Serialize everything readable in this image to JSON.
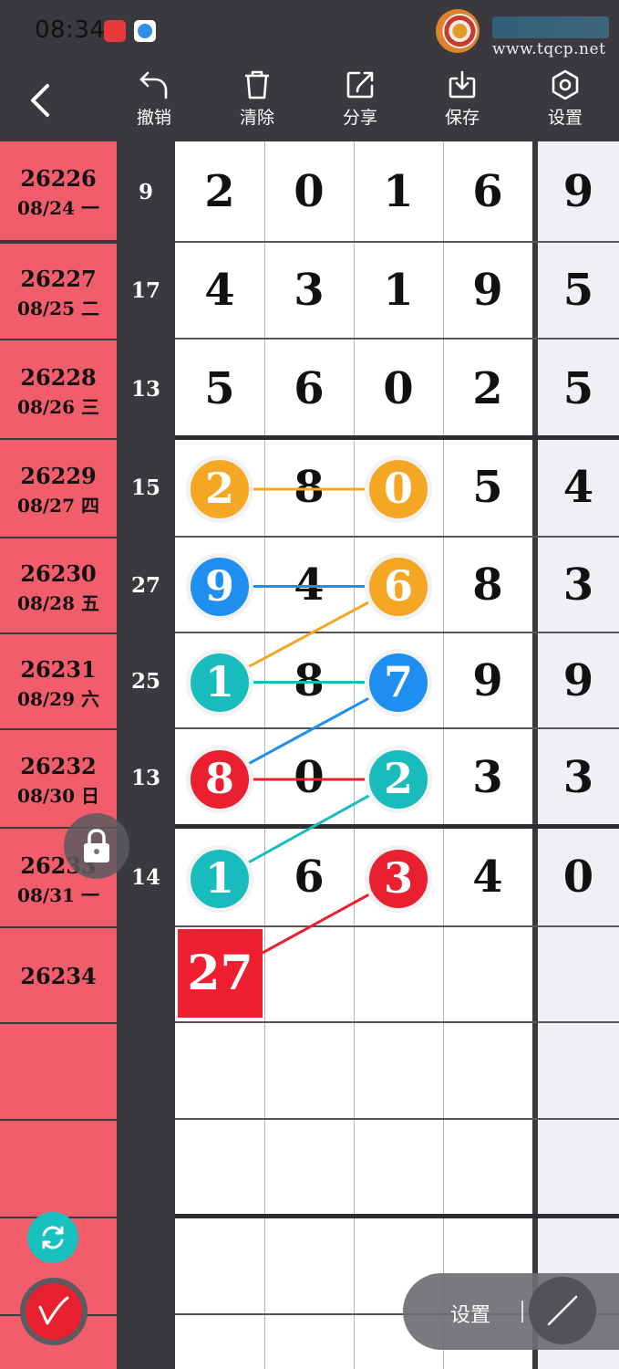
{
  "status_bar": {
    "time": "08:34"
  },
  "watermark": {
    "site": "www.tqcp.net"
  },
  "toolbar": {
    "undo": "撤销",
    "clear": "清除",
    "share": "分享",
    "save": "保存",
    "settings": "设置"
  },
  "rows": [
    {
      "issue": "26226",
      "date": "08/24 一",
      "sum": "9",
      "digits": [
        "2",
        "0",
        "1",
        "6"
      ],
      "extra": "9"
    },
    {
      "issue": "26227",
      "date": "08/25 二",
      "sum": "17",
      "digits": [
        "4",
        "3",
        "1",
        "9"
      ],
      "extra": "5"
    },
    {
      "issue": "26228",
      "date": "08/26 三",
      "sum": "13",
      "digits": [
        "5",
        "6",
        "0",
        "2"
      ],
      "extra": "5"
    },
    {
      "issue": "26229",
      "date": "08/27 四",
      "sum": "15",
      "digits": [
        "2",
        "8",
        "0",
        "5"
      ],
      "extra": "4"
    },
    {
      "issue": "26230",
      "date": "08/28 五",
      "sum": "27",
      "digits": [
        "9",
        "4",
        "6",
        "8"
      ],
      "extra": "3"
    },
    {
      "issue": "26231",
      "date": "08/29 六",
      "sum": "25",
      "digits": [
        "1",
        "8",
        "7",
        "9"
      ],
      "extra": "9"
    },
    {
      "issue": "26232",
      "date": "08/30 日",
      "sum": "13",
      "digits": [
        "8",
        "0",
        "2",
        "3"
      ],
      "extra": "3"
    },
    {
      "issue": "26233",
      "date": "08/31 一",
      "sum": "14",
      "digits": [
        "1",
        "6",
        "3",
        "4"
      ],
      "extra": "0"
    },
    {
      "issue": "26234",
      "date": "",
      "sum": "",
      "digits": [
        "",
        "",
        "",
        ""
      ],
      "extra": ""
    }
  ],
  "next_sum": "27",
  "bottom_bar": {
    "settings": "设置"
  },
  "colors": {
    "orange": "#f5a623",
    "blue": "#1e8ef0",
    "teal": "#19bcbc",
    "red": "#e8202f",
    "issue_bg": "#f25d6c",
    "panel": "#3a3a3e"
  },
  "icons": {
    "back": "chevron-left-icon",
    "undo": "undo-icon",
    "clear": "trash-icon",
    "share": "share-icon",
    "save": "download-icon",
    "settings": "hexagon-gear-icon",
    "lock": "lock-icon",
    "refresh": "refresh-icon",
    "pen": "pen-icon",
    "draw_line": "draw-line-icon"
  }
}
